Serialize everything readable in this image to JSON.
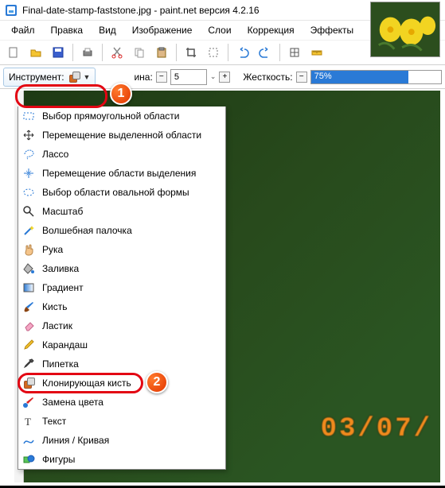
{
  "title": "Final-date-stamp-faststone.jpg - paint.net версия 4.2.16",
  "menu": {
    "file": "Файл",
    "edit": "Правка",
    "view": "Вид",
    "image": "Изображение",
    "layers": "Слои",
    "adjust": "Коррекция",
    "effects": "Эффекты"
  },
  "tool_label": "Инструмент:",
  "width_label_tail": "ина:",
  "width_value": "5",
  "hardness_label": "Жесткость:",
  "hardness_value": "75%",
  "datestamp": "03/07/",
  "tools": {
    "rect_select": "Выбор прямоугольной области",
    "move_sel": "Перемещение выделенной области",
    "lasso": "Лассо",
    "move_sel_area": "Перемещение области выделения",
    "ellipse_select": "Выбор области овальной формы",
    "zoom": "Масштаб",
    "wand": "Волшебная палочка",
    "hand": "Рука",
    "fill": "Заливка",
    "gradient": "Градиент",
    "brush": "Кисть",
    "eraser": "Ластик",
    "pencil": "Карандаш",
    "eyedropper": "Пипетка",
    "clone": "Клонирующая кисть",
    "recolor": "Замена цвета",
    "text": "Текст",
    "line": "Линия / Кривая",
    "shapes": "Фигуры"
  }
}
